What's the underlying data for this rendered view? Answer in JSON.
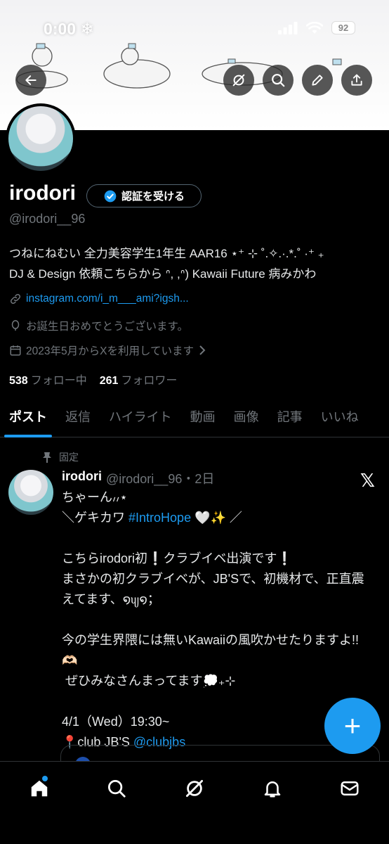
{
  "status": {
    "time": "0:00",
    "weather": "❄",
    "battery": "92"
  },
  "profile": {
    "name": "irodori",
    "verify_label": "認証を受ける",
    "handle": "@irodori__96",
    "bio_line1": "つねにねむい 全力美容学生1年生 AAR16 ⋆⁺ ⊹ ˚.✧.·.*.˚ ·⁺ ₊",
    "bio_line2": "DJ & Design 依頼こちらから ᐢ, ,ᐢ) Kawaii Future 病みかわ",
    "link": "instagram.com/i_m___ami?igsh...",
    "birthday": "お誕生日おめでとうございます。",
    "joined": "2023年5月からXを利用しています",
    "following_count": "538",
    "following_label": "フォロー中",
    "followers_count": "261",
    "followers_label": "フォロワー"
  },
  "tabs": [
    "ポスト",
    "返信",
    "ハイライト",
    "動画",
    "画像",
    "記事",
    "いいね"
  ],
  "post": {
    "pinned_label": "固定",
    "name": "irodori",
    "handle_time": "@irodori__96・2日",
    "line1": "ちゃーん៸៸⋆",
    "line2_pre": "＼ゲキカワ ",
    "line2_tag": "#IntroHope",
    "line2_post": " 🤍✨ ／",
    "para2": "こちらirodori初❕クラブイベ出演です❕\nまさかの初クラブイベが、JB'Sで、初機材で、正直震えてます、໑ᦼ໑；",
    "para3": "今の学生界隈には無いKawaiiの風吹かせたりますよ!!🫶🏻\n ぜひみなさんまってます💭₊⊹",
    "date_line": "4/1（Wed）19:30~",
    "venue_pre": "📍club JB'S ",
    "venue_mention": "@clubjbs"
  },
  "colors": {
    "accent": "#1d9bf0",
    "background": "#000000",
    "muted": "#71767b"
  }
}
